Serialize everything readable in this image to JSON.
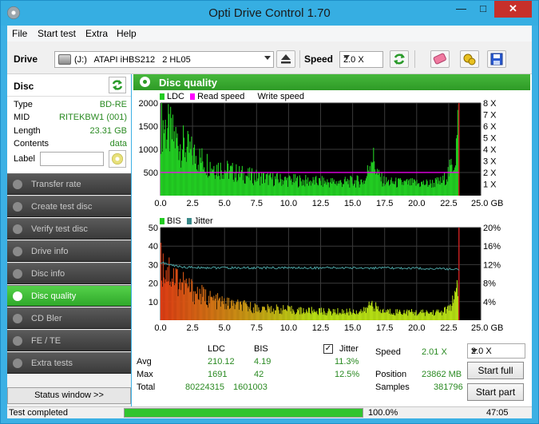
{
  "window": {
    "title": "Opti Drive Control 1.70",
    "minimize": "—",
    "maximize": "□",
    "close": "✕",
    "icon": "app-disc-icon"
  },
  "menu": [
    "File",
    "Start test",
    "Extra",
    "Help"
  ],
  "toolbar": {
    "drive_label": "Drive",
    "drive_value": "(J:)   ATAPI iHBS212   2 HL05",
    "speed_label": "Speed",
    "speed_value": "2.0 X",
    "icons": [
      "eject-icon",
      "refresh-speed-icon",
      "eraser-icon",
      "config-icon",
      "save-icon"
    ]
  },
  "disc": {
    "header": "Disc",
    "fields": [
      {
        "key": "Type",
        "value": "BD-RE"
      },
      {
        "key": "MID",
        "value": "RITEKBW1 (001)"
      },
      {
        "key": "Length",
        "value": "23.31 GB"
      },
      {
        "key": "Contents",
        "value": "data"
      }
    ],
    "label_key": "Label",
    "label_value": ""
  },
  "nav": [
    {
      "label": "Transfer rate",
      "active": false
    },
    {
      "label": "Create test disc",
      "active": false
    },
    {
      "label": "Verify test disc",
      "active": false
    },
    {
      "label": "Drive info",
      "active": false
    },
    {
      "label": "Disc info",
      "active": false
    },
    {
      "label": "Disc quality",
      "active": true
    },
    {
      "label": "CD Bler",
      "active": false
    },
    {
      "label": "FE / TE",
      "active": false
    },
    {
      "label": "Extra tests",
      "active": false
    }
  ],
  "status_window_button": "Status window >>",
  "panel_title": "Disc quality",
  "colors": {
    "ldc": "#22cc22",
    "read_speed": "#ff00ff",
    "bis": "#cc2200",
    "jitter": "#3a8a8a",
    "accent": "#2e9a26"
  },
  "chart_data": [
    {
      "type": "area",
      "legend": [
        "LDC",
        "Read speed",
        "Write speed"
      ],
      "x_ticks": [
        "0.0",
        "2.5",
        "5.0",
        "7.5",
        "10.0",
        "12.5",
        "15.0",
        "17.5",
        "20.0",
        "22.5",
        "25.0 GB"
      ],
      "xlim": [
        0,
        25
      ],
      "y_left_ticks": [
        "2000",
        "1500",
        "1000",
        "500"
      ],
      "ylim_left": [
        0,
        2000
      ],
      "y_right_ticks": [
        "8 X",
        "7 X",
        "6 X",
        "5 X",
        "4 X",
        "3 X",
        "2 X",
        "1 X"
      ],
      "ylim_right": [
        0,
        8
      ],
      "series": [
        {
          "name": "LDC",
          "x": [
            0,
            0.3,
            1,
            2,
            3,
            4,
            5,
            6,
            7,
            8,
            9,
            10,
            11,
            12,
            13,
            14,
            15,
            16,
            16.5,
            17,
            17.5,
            18,
            19,
            20,
            21,
            22,
            22.5,
            23,
            23.3
          ],
          "y": [
            1650,
            1500,
            1250,
            1000,
            800,
            650,
            560,
            480,
            420,
            380,
            350,
            330,
            320,
            300,
            290,
            285,
            300,
            320,
            900,
            420,
            300,
            280,
            270,
            260,
            260,
            300,
            500,
            800,
            1700
          ]
        },
        {
          "name": "Read speed",
          "x": [
            0,
            23.3
          ],
          "y": [
            2.0,
            2.0
          ]
        }
      ]
    },
    {
      "type": "area",
      "legend": [
        "BIS",
        "Jitter"
      ],
      "x_ticks": [
        "0.0",
        "2.5",
        "5.0",
        "7.5",
        "10.0",
        "12.5",
        "15.0",
        "17.5",
        "20.0",
        "22.5",
        "25.0 GB"
      ],
      "xlim": [
        0,
        25
      ],
      "y_left_ticks": [
        "50",
        "40",
        "30",
        "20",
        "10"
      ],
      "ylim_left": [
        0,
        50
      ],
      "y_right_ticks": [
        "20%",
        "16%",
        "12%",
        "8%",
        "4%"
      ],
      "ylim_right": [
        0,
        20
      ],
      "series": [
        {
          "name": "BIS",
          "x": [
            0,
            0.5,
            1,
            2,
            3,
            4,
            5,
            6,
            7,
            8,
            9,
            10,
            11,
            12,
            13,
            14,
            15,
            16,
            16.5,
            17,
            18,
            19,
            20,
            21,
            22,
            22.5,
            23,
            23.3
          ],
          "y": [
            30,
            28,
            24,
            18,
            14,
            11,
            9,
            8,
            7,
            6,
            6,
            5.5,
            5,
            5,
            4.5,
            4.5,
            4.5,
            5,
            10,
            5,
            4.5,
            4.5,
            4,
            4,
            4.5,
            6,
            12,
            18
          ]
        },
        {
          "name": "Jitter",
          "x": [
            0,
            1,
            2,
            5,
            10,
            15,
            20,
            23.3
          ],
          "y": [
            12.5,
            11.8,
            11.4,
            11.3,
            11.3,
            11.3,
            11.2,
            11.0
          ]
        }
      ]
    }
  ],
  "stats": {
    "col_ldc": "LDC",
    "col_bis": "BIS",
    "jitter_label": "Jitter",
    "rows": [
      {
        "label": "Avg",
        "ldc": "210.12",
        "bis": "4.19",
        "jitter": "11.3%"
      },
      {
        "label": "Max",
        "ldc": "1691",
        "bis": "42",
        "jitter": "12.5%"
      },
      {
        "label": "Total",
        "ldc": "80224315",
        "bis": "1601003",
        "jitter": ""
      }
    ],
    "speed_label": "Speed",
    "speed_value": "2.01 X",
    "speed_select": "2.0 X",
    "position_label": "Position",
    "position_value": "23862 MB",
    "samples_label": "Samples",
    "samples_value": "381796",
    "start_full": "Start full",
    "start_part": "Start part"
  },
  "statusbar": {
    "text": "Test completed",
    "progress": 1.0,
    "percent": "100.0%",
    "time": "47:05"
  }
}
